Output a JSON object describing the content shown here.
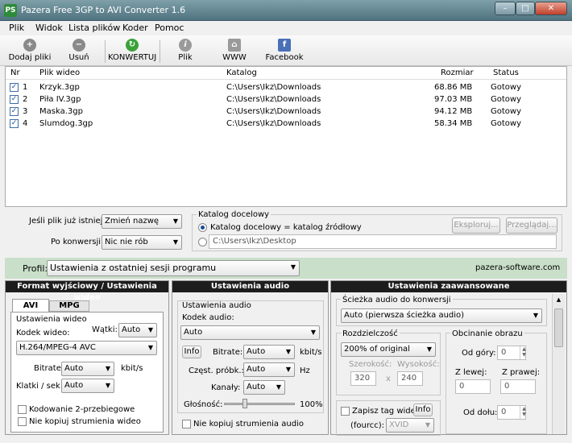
{
  "window": {
    "title": "Pazera Free 3GP to AVI Converter 1.6",
    "app_icon": "PS",
    "minimize": "–",
    "maximize": "□",
    "close": "✕"
  },
  "menu": [
    "Plik",
    "Widok",
    "Lista plików",
    "Koder",
    "Pomoc"
  ],
  "toolbar": {
    "add": "Dodaj pliki",
    "remove": "Usuń",
    "convert": "KONWERTUJ",
    "file": "Plik",
    "www": "WWW",
    "facebook": "Facebook"
  },
  "list": {
    "headers": {
      "nr": "Nr",
      "file": "Plik wideo",
      "dir": "Katalog",
      "size": "Rozmiar",
      "status": "Status"
    },
    "rows": [
      {
        "nr": "1",
        "file": "Krzyk.3gp",
        "dir": "C:\\Users\\Ikz\\Downloads",
        "size": "68.86 MB",
        "status": "Gotowy"
      },
      {
        "nr": "2",
        "file": "Piła IV.3gp",
        "dir": "C:\\Users\\Ikz\\Downloads",
        "size": "97.03 MB",
        "status": "Gotowy"
      },
      {
        "nr": "3",
        "file": "Maska.3gp",
        "dir": "C:\\Users\\Ikz\\Downloads",
        "size": "94.12 MB",
        "status": "Gotowy"
      },
      {
        "nr": "4",
        "file": "Slumdog.3gp",
        "dir": "C:\\Users\\Ikz\\Downloads",
        "size": "58.34 MB",
        "status": "Gotowy"
      }
    ]
  },
  "options": {
    "exists_label": "Jeśli plik już istnieje:",
    "exists_value": "Zmień nazwę",
    "after_label": "Po konwersji:",
    "after_value": "Nic nie rób",
    "target_group": "Katalog docelowy",
    "target_same": "Katalog docelowy = katalog źródłowy",
    "target_path": "C:\\Users\\Ikz\\Desktop",
    "explore": "Eksploruj...",
    "browse": "Przeglądaj..."
  },
  "profile": {
    "label": "Profil:",
    "value": "Ustawienia z ostatniej sesji programu",
    "site": "pazera-software.com"
  },
  "video": {
    "header": "Format wyjściowy / Ustawienia wideo",
    "tab_avi": "AVI",
    "tab_mpg": "MPG",
    "group": "Ustawienia wideo",
    "codec_label": "Kodek wideo:",
    "threads_label": "Wątki:",
    "threads_value": "Auto",
    "codec_value": "H.264/MPEG-4 AVC",
    "bitrate_label": "Bitrate:",
    "bitrate_value": "Auto",
    "bitrate_unit": "kbit/s",
    "fps_label": "Klatki / sek.:",
    "fps_value": "Auto",
    "twopass": "Kodowanie 2-przebiegowe",
    "nocopy": "Nie kopiuj strumienia wideo"
  },
  "audio": {
    "header": "Ustawienia audio",
    "group": "Ustawienia audio",
    "codec_label": "Kodek audio:",
    "codec_value": "Auto",
    "info": "Info",
    "bitrate_label": "Bitrate:",
    "bitrate_value": "Auto",
    "bitrate_unit": "kbit/s",
    "freq_label": "Częst. próbk.:",
    "freq_value": "Auto",
    "freq_unit": "Hz",
    "channels_label": "Kanały:",
    "channels_value": "Auto",
    "volume_label": "Głośność:",
    "volume_value": "100%",
    "volume_level": 0.3,
    "nocopy": "Nie kopiuj strumienia audio"
  },
  "advanced": {
    "header": "Ustawienia zaawansowane",
    "track_group": "Ścieżka audio do konwersji",
    "track_value": "Auto (pierwsza ścieżka audio)",
    "res_group": "Rozdzielczość",
    "res_value": "200% of original",
    "width_label": "Szerokość:",
    "height_label": "Wysokość:",
    "width_value": "320",
    "height_value": "240",
    "x": "x",
    "crop_group": "Obcinanie obrazu",
    "top_label": "Od góry:",
    "top_value": "0",
    "left_label": "Z lewej:",
    "left_value": "0",
    "right_label": "Z prawej:",
    "right_value": "0",
    "bottom_label": "Od dołu:",
    "bottom_value": "0",
    "tag_label": "Zapisz tag wideo",
    "tag_info": "Info",
    "fourcc_label": "(fourcc):",
    "fourcc_value": "XVID"
  }
}
